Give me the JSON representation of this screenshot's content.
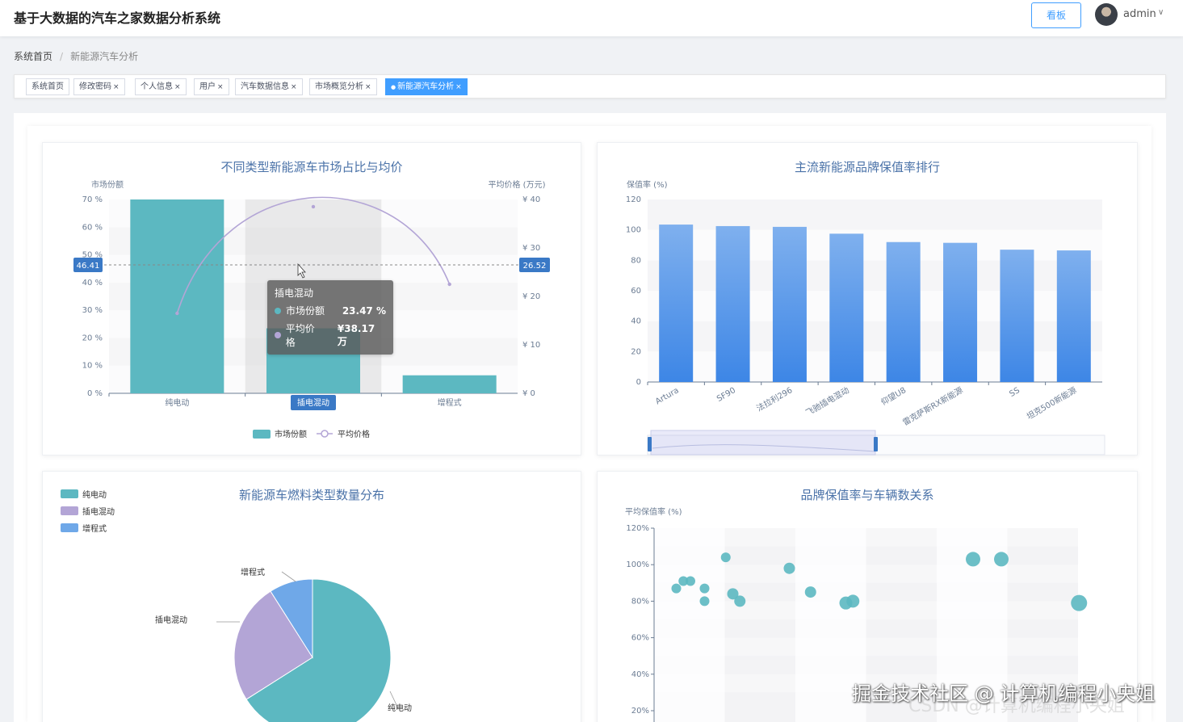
{
  "header": {
    "title": "基于大数据的汽车之家数据分析系统",
    "board_button": "看板",
    "user": "admin",
    "caret": "∨"
  },
  "breadcrumb": {
    "home": "系统首页",
    "sep": "/",
    "current": "新能源汽车分析"
  },
  "tags": [
    {
      "label": "系统首页",
      "closable": false,
      "active": false
    },
    {
      "label": "修改密码",
      "closable": true,
      "active": false
    },
    {
      "label": "个人信息",
      "closable": true,
      "active": false
    },
    {
      "label": "用户",
      "closable": true,
      "active": false
    },
    {
      "label": "汽车数据信息",
      "closable": true,
      "active": false
    },
    {
      "label": "市场概览分析",
      "closable": true,
      "active": false
    },
    {
      "label": "新能源汽车分析",
      "closable": true,
      "active": true
    }
  ],
  "tag_close": "×",
  "tag_active_dot": "●",
  "colors": {
    "primary": "#409eff",
    "teal": "#5cb8c1",
    "purple": "#b3a5d6",
    "blue_bar": "#4a8fe8",
    "pie_blue": "#6fa8e8"
  },
  "charts": {
    "market": {
      "title": "不同类型新能源车市场占比与均价",
      "tooltip": {
        "category": "插电混动",
        "rows": [
          {
            "name": "市场份额",
            "value": "23.47 %",
            "color": "#5cb8c1"
          },
          {
            "name": "平均价格",
            "value": "¥38.17 万",
            "color": "#b3a5d6"
          }
        ]
      },
      "crosshair": {
        "left_label": "46.41",
        "right_label": "26.52"
      }
    },
    "retention": {
      "title": "主流新能源品牌保值率排行"
    },
    "pie": {
      "title": "新能源车燃料类型数量分布"
    },
    "scatter": {
      "title": "品牌保值率与车辆数关系"
    }
  },
  "chart_data": [
    {
      "type": "bar",
      "title": "不同类型新能源车市场占比与均价",
      "categories": [
        "纯电动",
        "插电混动",
        "增程式"
      ],
      "series": [
        {
          "name": "市场份额",
          "type": "bar",
          "axis": "left",
          "values": [
            70.0,
            23.47,
            6.5
          ]
        },
        {
          "name": "平均价格",
          "type": "line",
          "axis": "right",
          "values": [
            16.5,
            38.17,
            22.5
          ]
        }
      ],
      "ylabel_left": "市场份额",
      "ylim_left": [
        0,
        70
      ],
      "ytick_left": [
        "0 %",
        "10 %",
        "20 %",
        "30 %",
        "40 %",
        "50 %",
        "60 %",
        "70 %"
      ],
      "ylabel_right": "平均价格 (万元)",
      "ylim_right": [
        0,
        40
      ],
      "ytick_right": [
        "¥ 0",
        "¥ 10",
        "¥ 20",
        "¥ 30",
        "¥ 40"
      ],
      "highlighted_category": "插电混动",
      "legend": [
        "市场份额",
        "平均价格"
      ]
    },
    {
      "type": "bar",
      "title": "主流新能源品牌保值率排行",
      "categories": [
        "Artura",
        "SF90",
        "法拉利296",
        "飞驰插电混动",
        "仰望U8",
        "雷克萨斯RX新能源",
        "SS",
        "坦克500新能源"
      ],
      "values": [
        103.5,
        102.5,
        102.0,
        97.5,
        92.0,
        91.5,
        87.0,
        86.5
      ],
      "ylabel": "保值率 (%)",
      "ylim": [
        0,
        120
      ],
      "yticks": [
        0,
        20,
        40,
        60,
        80,
        100,
        120
      ]
    },
    {
      "type": "pie",
      "title": "新能源车燃料类型数量分布",
      "slices": [
        {
          "name": "纯电动",
          "value": 66,
          "color": "#5cb8c1"
        },
        {
          "name": "插电混动",
          "value": 25,
          "color": "#b3a5d6"
        },
        {
          "name": "增程式",
          "value": 9,
          "color": "#6fa8e8"
        }
      ]
    },
    {
      "type": "scatter",
      "title": "品牌保值率与车辆数关系",
      "ylabel": "平均保值率 (%)",
      "ylim": [
        20,
        120
      ],
      "yticks": [
        "20%",
        "40%",
        "60%",
        "80%",
        "100%",
        "120%"
      ],
      "points": [
        {
          "x": 1,
          "y": 87,
          "s": 6
        },
        {
          "x": 1.5,
          "y": 91,
          "s": 6
        },
        {
          "x": 2,
          "y": 91,
          "s": 6
        },
        {
          "x": 3,
          "y": 87,
          "s": 6
        },
        {
          "x": 3,
          "y": 80,
          "s": 6
        },
        {
          "x": 4.5,
          "y": 104,
          "s": 6
        },
        {
          "x": 5,
          "y": 84,
          "s": 7
        },
        {
          "x": 5.5,
          "y": 80,
          "s": 7
        },
        {
          "x": 9,
          "y": 98,
          "s": 7
        },
        {
          "x": 10.5,
          "y": 85,
          "s": 7
        },
        {
          "x": 13,
          "y": 79,
          "s": 8
        },
        {
          "x": 13.5,
          "y": 80,
          "s": 8
        },
        {
          "x": 22,
          "y": 103,
          "s": 9
        },
        {
          "x": 24,
          "y": 103,
          "s": 9
        },
        {
          "x": 29.5,
          "y": 79,
          "s": 10
        }
      ]
    }
  ],
  "watermark": "掘金技术社区 @ 计算机编程小央姐",
  "watermark2": "CSDN @计算机编程小央姐"
}
